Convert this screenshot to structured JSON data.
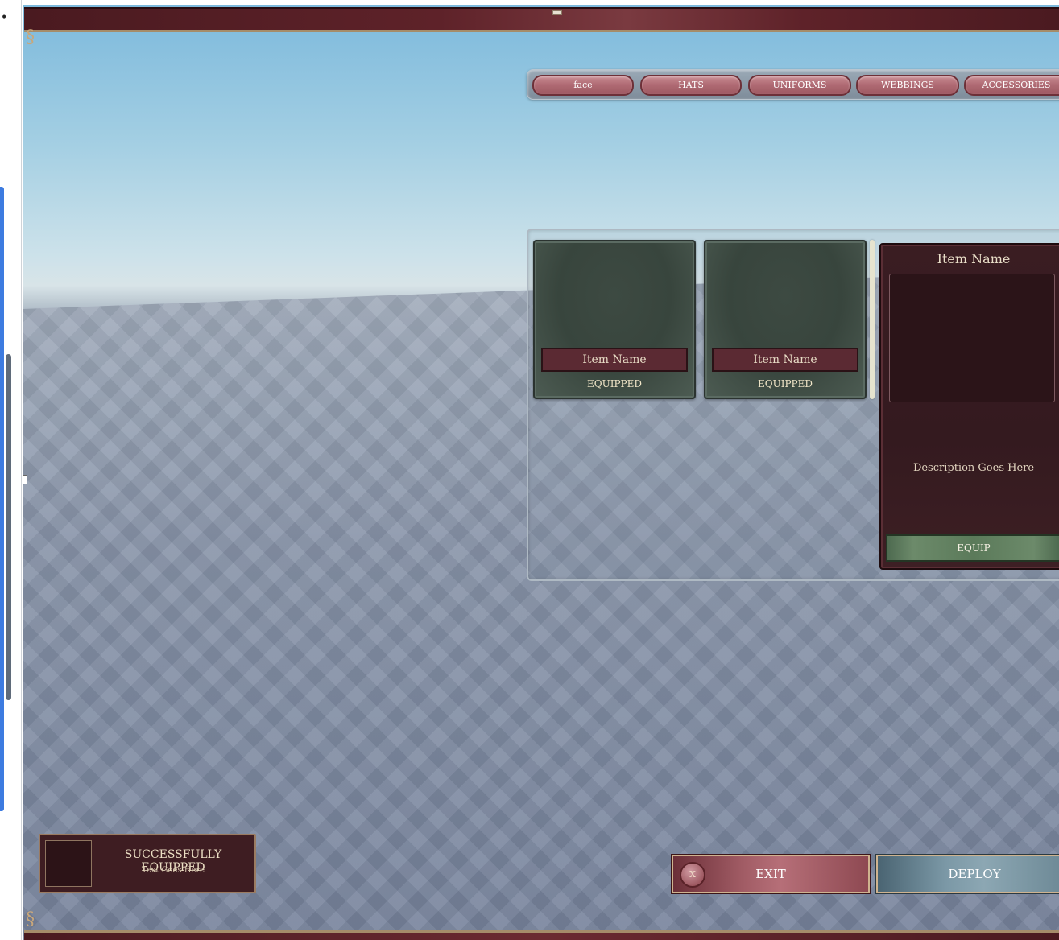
{
  "tabs": [
    {
      "label": "face"
    },
    {
      "label": "HATS"
    },
    {
      "label": "UNIFORMS"
    },
    {
      "label": "WEBBINGS"
    },
    {
      "label": "ACCESSORIES"
    }
  ],
  "items": [
    {
      "name": "Item Name",
      "status": "EQUIPPED"
    },
    {
      "name": "Item Name",
      "status": "EQUIPPED"
    }
  ],
  "detail": {
    "title": "Item Name",
    "description": "Description Goes Here",
    "equip_label": "EQUIP"
  },
  "notification": {
    "title": "SUCCESSFULLY EQUIPPED",
    "text": "Text Goes Here"
  },
  "actions": {
    "exit_icon": "X",
    "exit_label": "EXIT",
    "deploy_label": "DEPLOY"
  },
  "gutter": {
    "marker": "•"
  },
  "colors": {
    "maroon": "#5e2229",
    "gold_trim": "#a58c6a",
    "card_green": "#3d4a42",
    "equip_green": "#5b7a5a",
    "deploy_blue": "#7b98a6"
  }
}
